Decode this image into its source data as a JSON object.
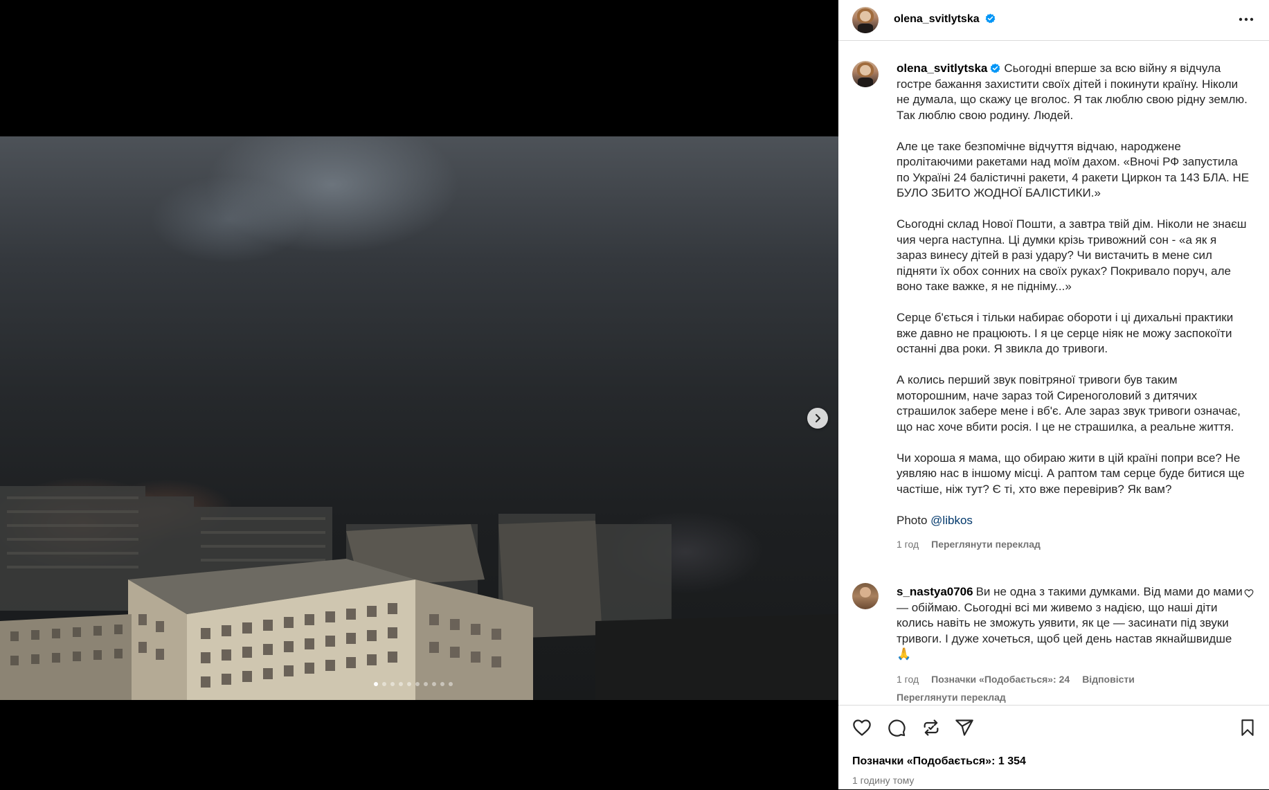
{
  "author": {
    "username": "olena_svitlytska"
  },
  "caption": {
    "paragraphs": [
      "Сьогодні вперше за всю війну я відчула гостре бажання захистити своїх дітей і покинути країну. Ніколи не думала, що скажу це вголос. Я так люблю свою рідну землю. Так люблю свою родину. Людей.",
      "Але це таке безпомічне відчуття відчаю, народжене пролітаючими ракетами над моїм дахом. «Вночі РФ запустила по Україні 24 балістичні ракети, 4 ракети Циркон та 143 БЛА. НЕ БУЛО ЗБИТО ЖОДНОЇ БАЛІСТИКИ.»",
      "Сьогодні склад Нової Пошти, а завтра твій дім. Ніколи не знаєш чия черга наступна. Ці думки крізь тривожний сон - «а як я зараз винесу дітей в разі удару? Чи вистачить в мене сил підняти їх обох сонних на своїх руках? Покривало поруч, але воно таке важке, я не підніму...»",
      "Серце б'ється і тільки набирає обороти і ці дихальні практики вже давно не працюють. І я це серце ніяк не можу заспокоїти останні два роки. Я звикла до тривоги.",
      "А колись перший звук повітряної тривоги був таким моторошним, наче зараз той Сиреноголовий з дитячих страшилок забере мене і вб'є. Але зараз звук тривоги означає, що нас хоче вбити росія. І це не страшилка, а реальне життя.",
      "Чи хороша я мама, що обираю жити в цій країні попри все? Не уявляю нас в іншому місці. А раптом там серце буде битися ще частіше, ніж тут? Є ті, хто вже перевірив? Як вам?"
    ],
    "photo_label": "Photo",
    "photo_mention": "@libkos",
    "time": "1 год",
    "translate": "Переглянути переклад"
  },
  "comment": {
    "username": "s_nastya0706",
    "text": "Ви не одна з такими думками. Від мами до мами — обіймаю. Сьогодні всі ми живемо з надією, що наші діти колись навіть не зможуть уявити, як це — засинати під звуки тривоги. І дуже хочеться, щоб цей день настав якнайшвидше 🙏",
    "time": "1 год",
    "likes": "Позначки «Подобається»: 24",
    "reply": "Відповісти",
    "translate": "Переглянути переклад"
  },
  "post": {
    "likes": "Позначки «Подобається»: 1 354",
    "time": "1 годину тому"
  },
  "carousel": {
    "slide_count": 10,
    "active_index": 0
  },
  "icons": {
    "verified": "verified-badge-icon",
    "more": "more-icon",
    "next": "chevron-right-icon",
    "like": "heart-icon",
    "comment": "comment-icon",
    "repost": "repost-icon",
    "share": "send-icon",
    "save": "bookmark-icon"
  },
  "colors": {
    "verified": "#0095f6",
    "link": "#00376b",
    "secondary_text": "#737373",
    "border": "#dbdbdb"
  }
}
